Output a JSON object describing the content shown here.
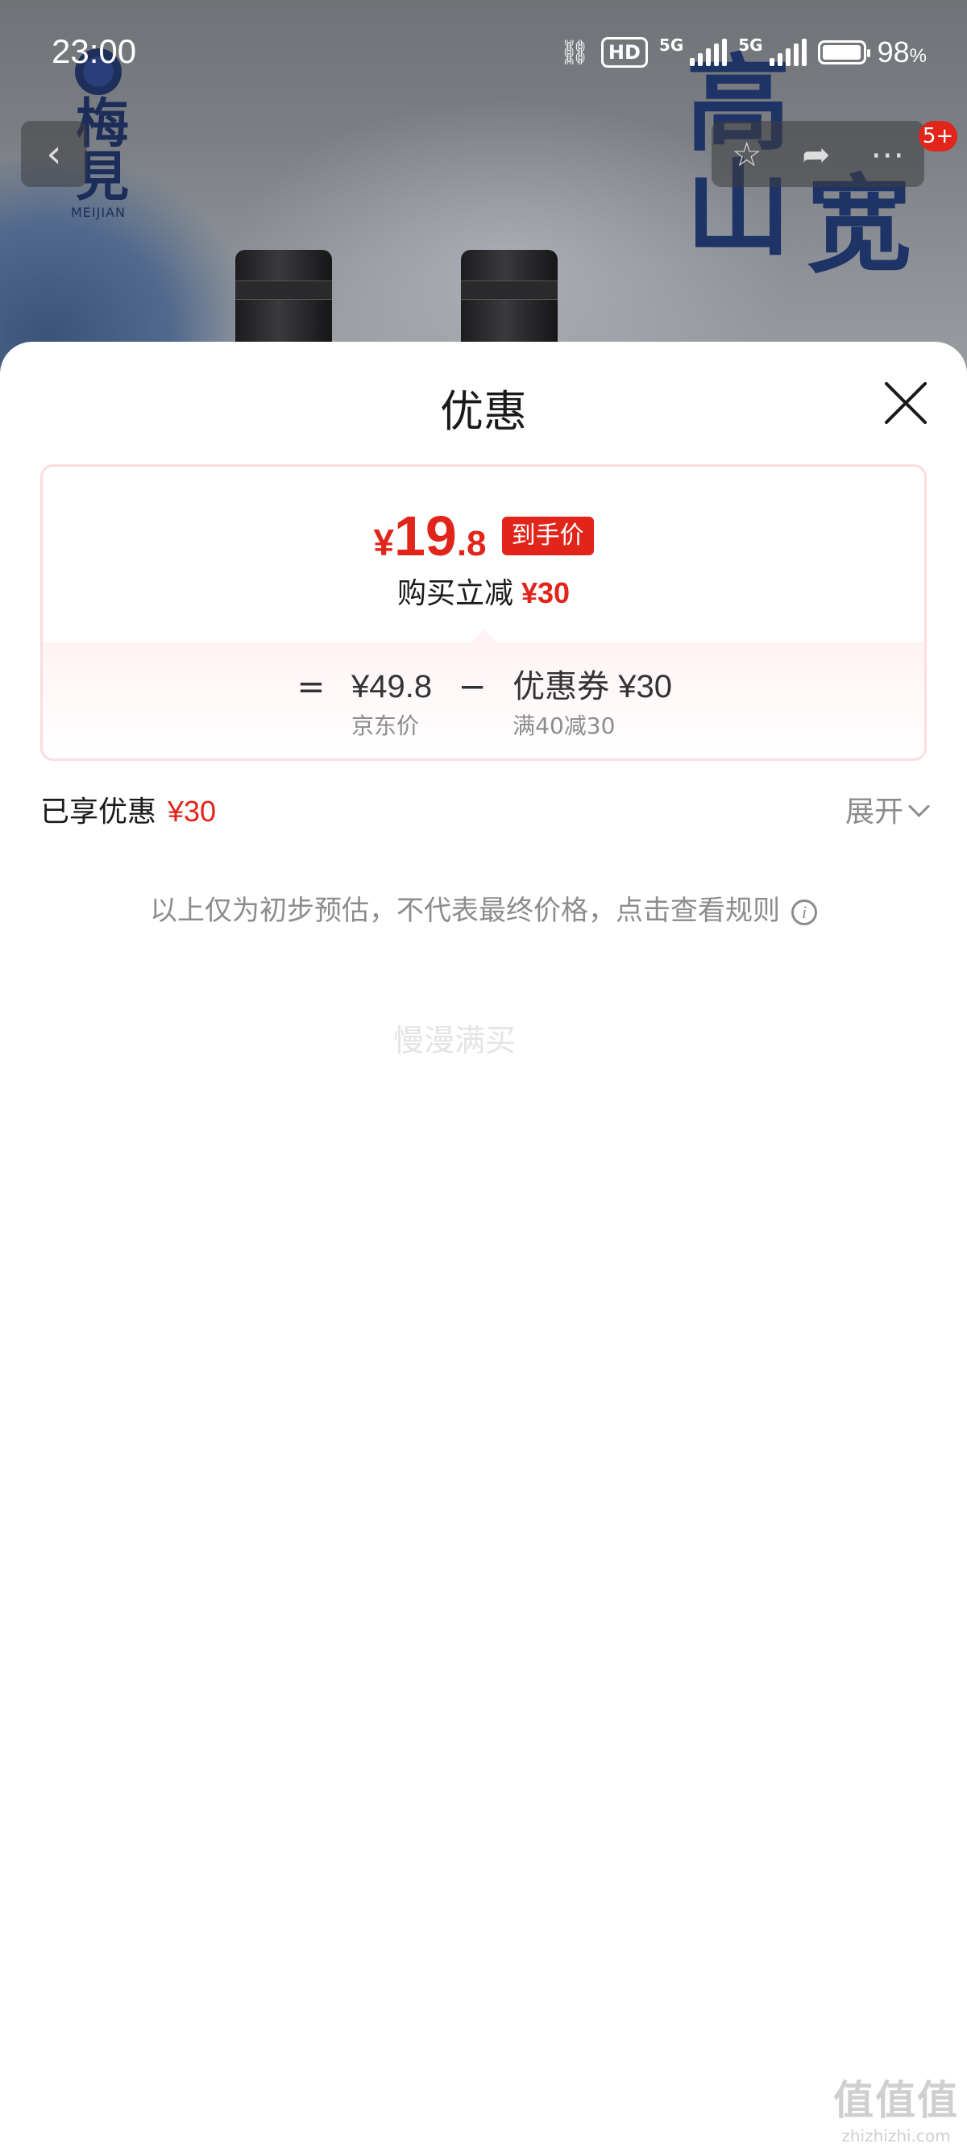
{
  "status_bar": {
    "time": "23:00",
    "hd_label": "HD",
    "network_1": "5G",
    "network_2": "5G",
    "battery_percent": "98",
    "battery_unit": "%",
    "battery_level": 0.98
  },
  "background": {
    "logo_text": "梅見",
    "logo_subtitle": "MEIJIAN",
    "calligraphy_col1": "高山",
    "calligraphy_col2": "宽"
  },
  "nav": {
    "back_icon": "chevron-left-icon",
    "favorite_icon": "star-icon",
    "share_icon": "share-icon",
    "more_icon": "more-icon",
    "badge": "5+"
  },
  "sheet": {
    "title": "优惠",
    "close_icon": "close-icon",
    "final_price": {
      "yen": "¥",
      "integer": "19",
      "decimal": ".8"
    },
    "final_tag": "到手价",
    "reduce_label": "购买立减",
    "reduce_amount": "¥30",
    "calc": {
      "equals": "=",
      "base_price": "¥49.8",
      "base_label": "京东价",
      "minus": "−",
      "coupon_value": "优惠券 ¥30",
      "coupon_rule": "满40减30"
    },
    "enjoyed_label": "已享优惠",
    "enjoyed_amount": "¥30",
    "expand_label": "展开",
    "notice": "以上仅为初步预估，不代表最终价格，点击查看规则",
    "faint_text": "慢漫满买"
  },
  "watermark": {
    "mark": "值值值",
    "text": "zhizhizhi.com"
  },
  "colors": {
    "accent_red": "#e1251b",
    "card_border": "#fbdcdf",
    "muted_text": "#8c8c8c"
  }
}
